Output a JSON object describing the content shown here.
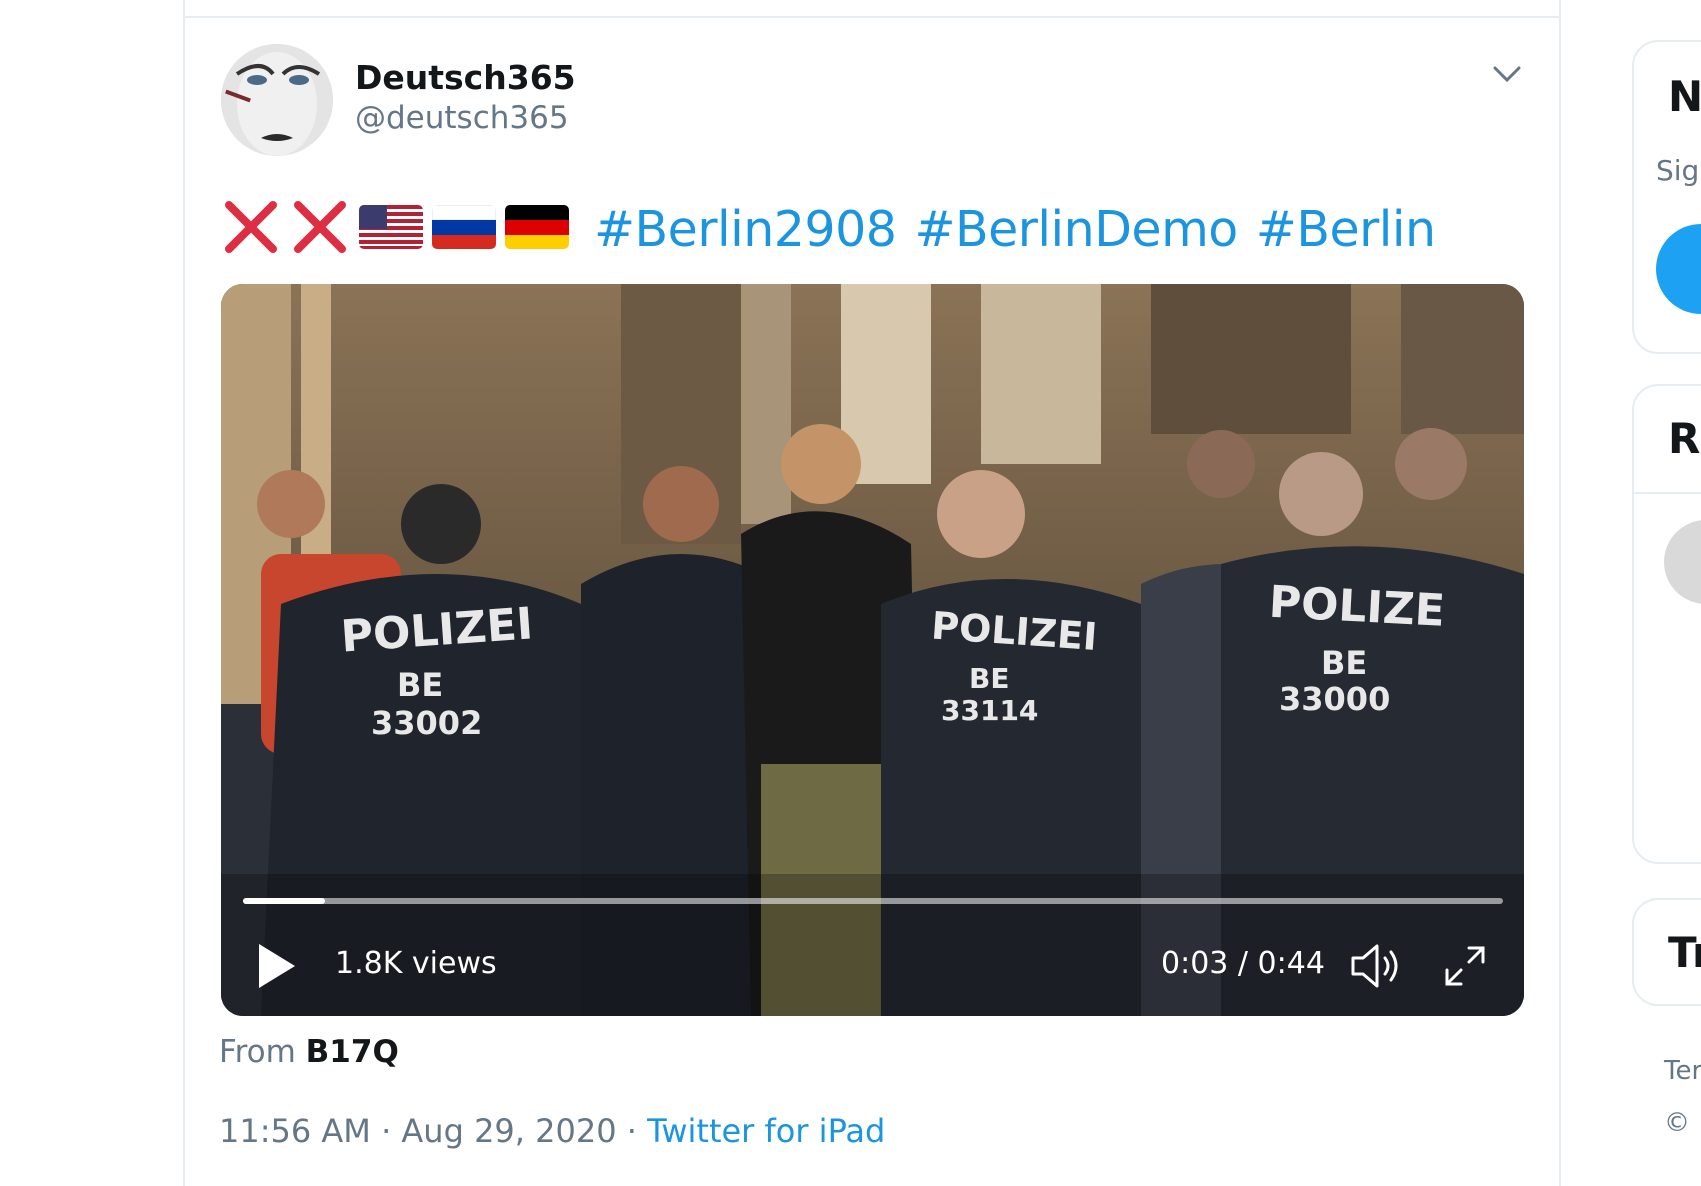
{
  "tweet": {
    "author_name": "Deutsch365",
    "author_handle": "@deutsch365",
    "emojis": [
      "cross-mark",
      "cross-mark",
      "us-flag",
      "russia-flag",
      "germany-flag"
    ],
    "hashtags": [
      "#Berlin2908",
      "#BerlinDemo",
      "#Berlin"
    ],
    "video": {
      "views": "1.8K views",
      "time": "0:03 / 0:44",
      "progress": 0.065,
      "overlay_text": [
        {
          "text": "POLIZEI"
        },
        {
          "text": "BE"
        },
        {
          "text": "33002"
        },
        {
          "text": "POLIZEI"
        },
        {
          "text": "BE"
        },
        {
          "text": "33114"
        },
        {
          "text": "POLIZE"
        },
        {
          "text": "BE"
        },
        {
          "text": "33000"
        }
      ]
    },
    "from_label": "From",
    "from_source": "B17Q",
    "timestamp": "11:56 AM · Aug 29, 2020 · ",
    "client": "Twitter for iPad"
  },
  "sidebar": {
    "card1_title": "N",
    "card1_sub": "Sign",
    "card2_title": "Re",
    "card3_title": "Tr",
    "footer1": "Ter",
    "footer2": "©"
  },
  "colors": {
    "link": "#1b95e0",
    "secondary_text": "#657786",
    "border": "#e6ecf0",
    "button": "#1da1f2"
  }
}
